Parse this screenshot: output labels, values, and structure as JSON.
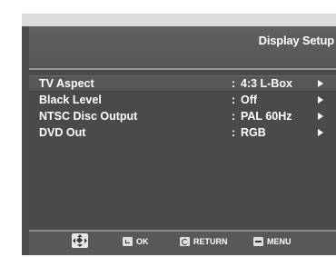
{
  "screen": {
    "title": "Display Setup"
  },
  "menu": {
    "items": [
      {
        "label": "TV Aspect",
        "separator": ":",
        "value": "4:3 L-Box",
        "selected": true
      },
      {
        "label": "Black Level",
        "separator": ":",
        "value": "Off",
        "selected": false
      },
      {
        "label": "NTSC Disc Output",
        "separator": ":",
        "value": "PAL 60Hz",
        "selected": false
      },
      {
        "label": "DVD Out",
        "separator": ":",
        "value": "RGB",
        "selected": false
      }
    ]
  },
  "footer": {
    "nav_icon": "directional-pad-icon",
    "ok_label": "OK",
    "return_label": "RETURN",
    "menu_label": "MENU"
  },
  "colors": {
    "panel": "#4a4a4a",
    "text": "#ffffff",
    "header_bar": "#dcdcdc"
  }
}
